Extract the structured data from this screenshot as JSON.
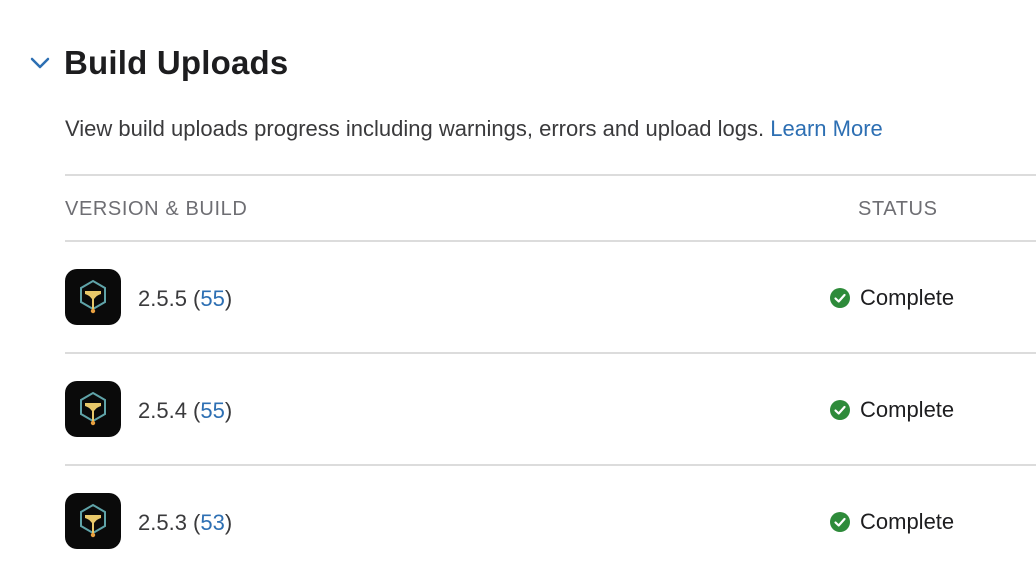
{
  "section": {
    "title": "Build Uploads",
    "expanded_icon": "chevron-down-icon",
    "description": "View build uploads progress including warnings, errors and upload logs.",
    "learn_more": "Learn More"
  },
  "table": {
    "columns": {
      "version": "VERSION & BUILD",
      "status": "STATUS"
    },
    "rows": [
      {
        "version": "2.5.5",
        "build": "55",
        "status": "Complete",
        "status_icon": "check-circle-icon"
      },
      {
        "version": "2.5.4",
        "build": "55",
        "status": "Complete",
        "status_icon": "check-circle-icon"
      },
      {
        "version": "2.5.3",
        "build": "53",
        "status": "Complete",
        "status_icon": "check-circle-icon"
      }
    ]
  },
  "colors": {
    "link": "#2d6fb3",
    "success": "#2e8b3a",
    "icon_gold": "#e8c86a",
    "icon_teal": "#5fa3a8"
  }
}
